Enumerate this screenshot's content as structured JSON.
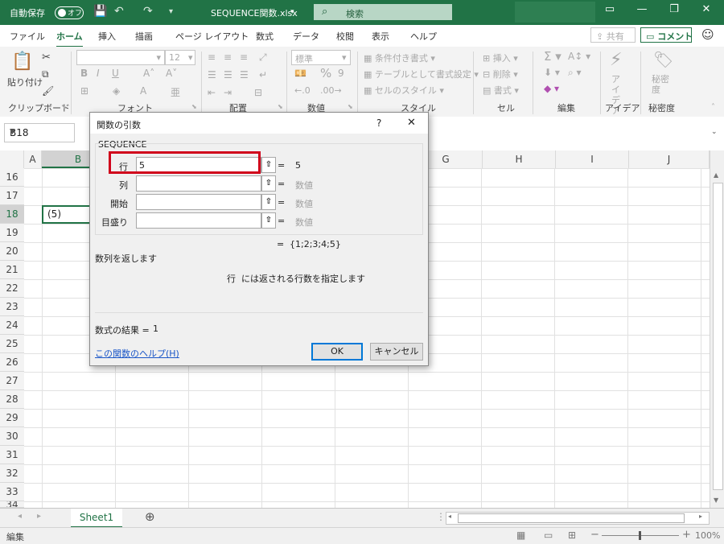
{
  "titlebar": {
    "autosave_label": "自動保存",
    "autosave_state": "オフ",
    "filename": "SEQUENCE関数.xlsx",
    "search_placeholder": "検索"
  },
  "menu": {
    "tabs": [
      "ファイル",
      "ホーム",
      "挿入",
      "描画",
      "ページ レイアウト",
      "数式",
      "データ",
      "校閲",
      "表示",
      "ヘルプ"
    ],
    "active_tab": "ホーム",
    "share_label": "共有",
    "comment_label": "コメント"
  },
  "ribbon": {
    "clipboard": {
      "paste_label": "貼り付け",
      "group_label": "クリップボード"
    },
    "font": {
      "size_value": "12",
      "group_label": "フォント"
    },
    "alignment": {
      "group_label": "配置"
    },
    "number": {
      "format_value": "標準",
      "group_label": "数値"
    },
    "styles": {
      "conditional": "条件付き書式",
      "table": "テーブルとして書式設定",
      "cell_styles": "セルのスタイル",
      "group_label": "スタイル"
    },
    "cells": {
      "insert": "挿入",
      "delete": "削除",
      "format": "書式",
      "group_label": "セル"
    },
    "editing": {
      "group_label": "編集"
    },
    "ideas": {
      "label": "アイデア",
      "group_label": "アイデア"
    },
    "sensitivity": {
      "label": "秘密度",
      "group_label": "秘密度"
    }
  },
  "formula_bar": {
    "name_box": "B18"
  },
  "grid": {
    "columns": [
      "A",
      "B",
      "C",
      "D",
      "E",
      "F",
      "G",
      "H",
      "I",
      "J"
    ],
    "rows": [
      "16",
      "17",
      "18",
      "19",
      "20",
      "21",
      "22",
      "23",
      "24",
      "25",
      "26",
      "27",
      "28",
      "29",
      "30",
      "31",
      "32",
      "33",
      "34"
    ],
    "selected_cell_value": "(5)"
  },
  "dialog": {
    "title": "関数の引数",
    "help_char": "?",
    "close_char": "✕",
    "function_name": "SEQUENCE",
    "args": [
      {
        "label": "行",
        "value": "5",
        "result": "5"
      },
      {
        "label": "列",
        "value": "",
        "result": "数値"
      },
      {
        "label": "開始",
        "value": "",
        "result": "数値"
      },
      {
        "label": "目盛り",
        "value": "",
        "result": "数値"
      }
    ],
    "equals": "=",
    "formula_result_preview": "{1;2;3;4;5}",
    "description": "数列を返します",
    "arg_description_name": "行",
    "arg_description": "には返される行数を指定します",
    "result_label": "数式の結果 =",
    "result_value": "1",
    "help_link": "この関数のヘルプ(H)",
    "ok_label": "OK",
    "cancel_label": "キャンセル"
  },
  "sheets": {
    "active": "Sheet1"
  },
  "status": {
    "mode": "編集",
    "zoom": "100%"
  },
  "colors": {
    "accent": "#217346",
    "highlight_box": "#d0021b"
  }
}
